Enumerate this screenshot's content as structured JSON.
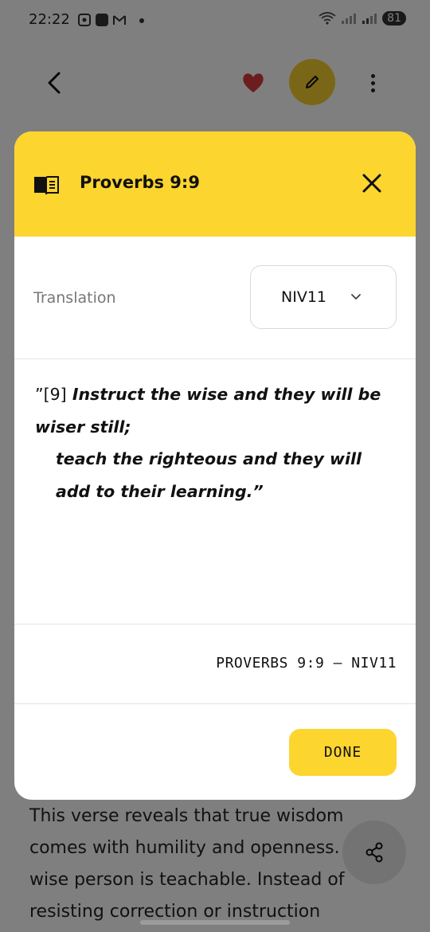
{
  "status_bar": {
    "time": "22:22",
    "battery": "81"
  },
  "toolbar": {
    "icons": [
      "back-icon",
      "heart-icon",
      "edit-icon",
      "more-vert-icon"
    ],
    "heart_color": "#d93a3a",
    "edit_button_color": "#f2cf2e"
  },
  "dialog": {
    "title": "Proverbs 9:9",
    "header_color": "#fdd52f",
    "translation_label": "Translation",
    "translation_value": "NIV11",
    "verse": {
      "open_quote": "”[9]",
      "line1": "Instruct the wise and they will be wiser still;",
      "line2": "teach the righteous and they will add to their learning.",
      "close_quote": "”"
    },
    "reference": "PROVERBS 9:9 — NIV11",
    "done_label": "DONE"
  },
  "background": {
    "text": "This verse reveals that true wisdom comes with humility and openness. A wise person is teachable. Instead of resisting correction or instruction"
  }
}
